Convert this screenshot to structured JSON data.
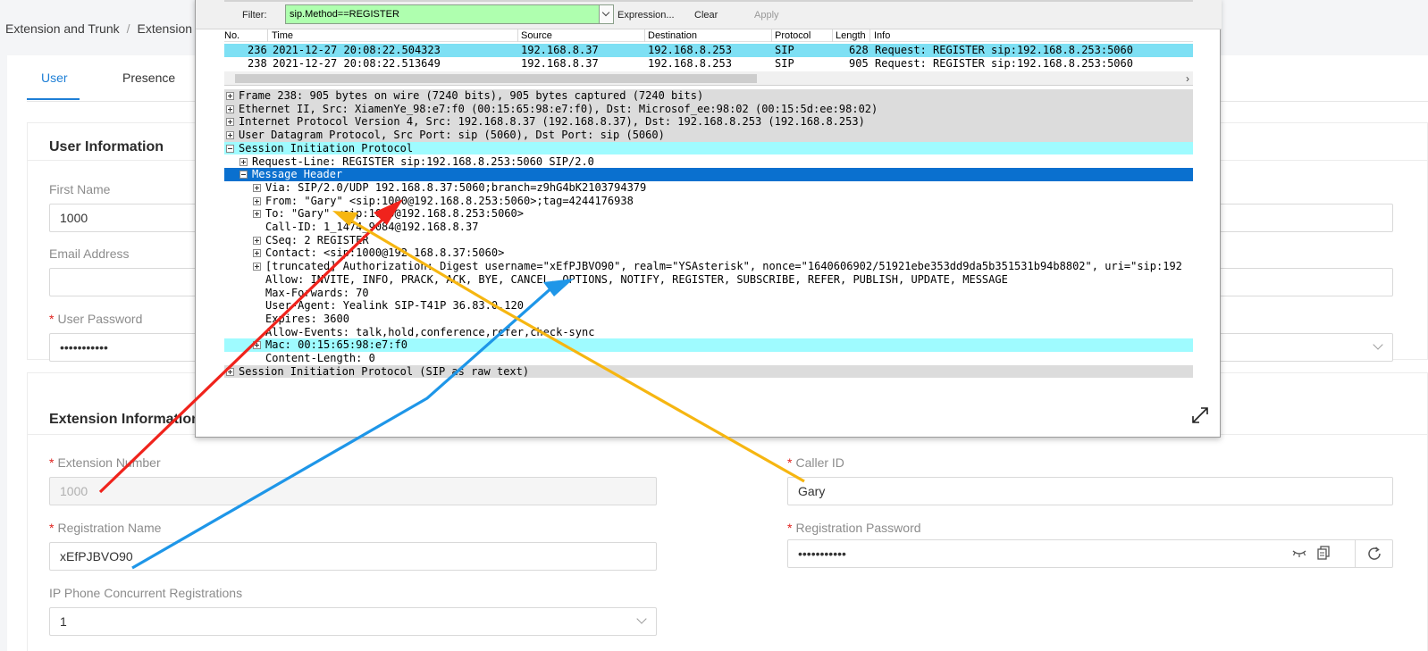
{
  "breadcrumb": {
    "item1": "Extension and Trunk",
    "separator": "/",
    "item2": "Extension"
  },
  "tabs": {
    "user": "User",
    "presence": "Presence"
  },
  "user_info": {
    "title": "User Information",
    "first_name_label": "First Name",
    "first_name_value": "1000",
    "email_label": "Email Address",
    "email_value": "",
    "password_label": "User Password",
    "password_value": "•••••••••••"
  },
  "ext_info": {
    "title": "Extension Information",
    "ext_number_label": "Extension Number",
    "ext_number_value": "1000",
    "reg_name_label": "Registration Name",
    "reg_name_value": "xEfPJBVO90",
    "concurrent_label": "IP Phone Concurrent Registrations",
    "concurrent_value": "1",
    "caller_id_label": "Caller ID",
    "caller_id_value": "Gary",
    "reg_password_label": "Registration Password",
    "reg_password_value": "•••••••••••"
  },
  "wireshark": {
    "filter_label": "Filter:",
    "filter_value": "sip.Method==REGISTER",
    "expression": "Expression...",
    "clear": "Clear",
    "apply": "Apply",
    "columns": {
      "no": "No.",
      "time": "Time",
      "source": "Source",
      "destination": "Destination",
      "protocol": "Protocol",
      "length": "Length",
      "info": "Info"
    },
    "packets": [
      {
        "no": "236",
        "time": "2021-12-27 20:08:22.504323",
        "source": "192.168.8.37",
        "destination": "192.168.8.253",
        "protocol": "SIP",
        "length": "628",
        "info": "Request: REGISTER sip:192.168.8.253:5060"
      },
      {
        "no": "238",
        "time": "2021-12-27 20:08:22.513649",
        "source": "192.168.8.37",
        "destination": "192.168.8.253",
        "protocol": "SIP",
        "length": "905",
        "info": "Request: REGISTER sip:192.168.8.253:5060"
      }
    ],
    "details": [
      {
        "text": "Frame 238: 905 bytes on wire (7240 bits), 905 bytes captured (7240 bits)",
        "indent": 0,
        "toggle": "plus",
        "style": "gray"
      },
      {
        "text": "Ethernet II, Src: XiamenYe_98:e7:f0 (00:15:65:98:e7:f0), Dst: Microsof_ee:98:02 (00:15:5d:ee:98:02)",
        "indent": 0,
        "toggle": "plus",
        "style": "gray"
      },
      {
        "text": "Internet Protocol Version 4, Src: 192.168.8.37 (192.168.8.37), Dst: 192.168.8.253 (192.168.8.253)",
        "indent": 0,
        "toggle": "plus",
        "style": "gray"
      },
      {
        "text": "User Datagram Protocol, Src Port: sip (5060), Dst Port: sip (5060)",
        "indent": 0,
        "toggle": "plus",
        "style": "gray"
      },
      {
        "text": "Session Initiation Protocol",
        "indent": 0,
        "toggle": "minus",
        "style": "cyan"
      },
      {
        "text": "Request-Line: REGISTER sip:192.168.8.253:5060 SIP/2.0",
        "indent": 1,
        "toggle": "plus",
        "style": ""
      },
      {
        "text": "Message Header",
        "indent": 1,
        "toggle": "minus",
        "style": "blue"
      },
      {
        "text": "Via: SIP/2.0/UDP 192.168.8.37:5060;branch=z9hG4bK2103794379",
        "indent": 2,
        "toggle": "plus",
        "style": ""
      },
      {
        "text": "From: \"Gary\" <sip:1000@192.168.8.253:5060>;tag=4244176938",
        "indent": 2,
        "toggle": "plus",
        "style": ""
      },
      {
        "text": "To: \"Gary\" <sip:1000@192.168.8.253:5060>",
        "indent": 2,
        "toggle": "plus",
        "style": ""
      },
      {
        "text": "Call-ID: 1_1474_9084@192.168.8.37",
        "indent": 2,
        "toggle": "",
        "style": ""
      },
      {
        "text": "CSeq: 2 REGISTER",
        "indent": 2,
        "toggle": "plus",
        "style": ""
      },
      {
        "text": "Contact: <sip:1000@192.168.8.37:5060>",
        "indent": 2,
        "toggle": "plus",
        "style": ""
      },
      {
        "text": "[truncated] Authorization: Digest username=\"xEfPJBVO90\", realm=\"YSAsterisk\", nonce=\"1640606902/51921ebe353dd9da5b351531b94b8802\", uri=\"sip:192",
        "indent": 2,
        "toggle": "plus",
        "style": ""
      },
      {
        "text": "Allow: INVITE, INFO, PRACK, ACK, BYE, CANCEL, OPTIONS, NOTIFY, REGISTER, SUBSCRIBE, REFER, PUBLISH, UPDATE, MESSAGE",
        "indent": 2,
        "toggle": "",
        "style": ""
      },
      {
        "text": "Max-Forwards: 70",
        "indent": 2,
        "toggle": "",
        "style": ""
      },
      {
        "text": "User-Agent: Yealink SIP-T41P 36.83.0.120",
        "indent": 2,
        "toggle": "",
        "style": ""
      },
      {
        "text": "Expires: 3600",
        "indent": 2,
        "toggle": "",
        "style": ""
      },
      {
        "text": "Allow-Events: talk,hold,conference,refer,check-sync",
        "indent": 2,
        "toggle": "",
        "style": ""
      },
      {
        "text": "Mac: 00:15:65:98:e7:f0",
        "indent": 2,
        "toggle": "plus",
        "style": "cyan"
      },
      {
        "text": "Content-Length: 0",
        "indent": 2,
        "toggle": "",
        "style": ""
      },
      {
        "text": "Session Initiation Protocol (SIP as raw text)",
        "indent": 0,
        "toggle": "plus",
        "style": "gray"
      }
    ]
  },
  "colors": {
    "accent": "#1e7fd6",
    "required": "#e0201c",
    "filter_ok": "#afffaf",
    "row_selected": "#7ee0f4",
    "tree_selected": "#0a70cf",
    "arrow_red": "#f0231c",
    "arrow_blue": "#1e96e8",
    "arrow_yellow": "#f6b611"
  }
}
